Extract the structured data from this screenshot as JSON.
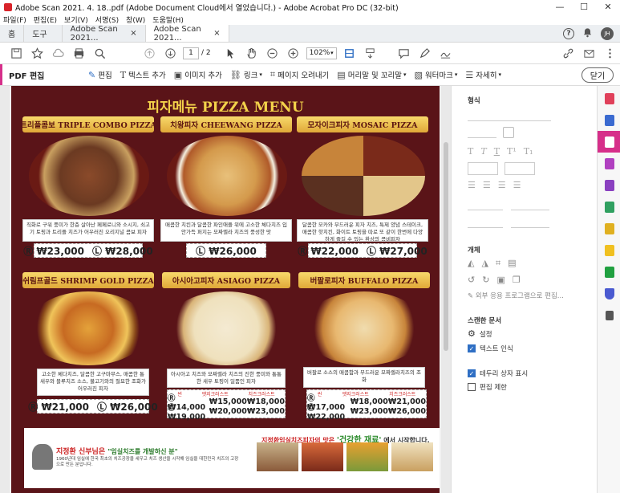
{
  "window": {
    "title": "Adobe Scan 2021. 4. 18..pdf (Adobe Document Cloud에서 열었습니다.) - Adobe Acrobat Pro DC (32-bit)",
    "minimize": "—",
    "maximize": "☐",
    "close": "✕"
  },
  "menu": [
    "파일(F)",
    "편집(E)",
    "보기(V)",
    "서명(S)",
    "창(W)",
    "도움말(H)"
  ],
  "tabs": {
    "home": "홈",
    "tools": "도구",
    "doc1": "Adobe Scan 2021...",
    "doc2": "Adobe Scan 2021...",
    "close": "×"
  },
  "topright": {
    "help": "?",
    "avatar": "JH"
  },
  "toolbar": {
    "page_current": "1",
    "page_total": "/ 2",
    "zoom": "102%"
  },
  "editbar": {
    "title": "PDF 편집",
    "edit": "편집",
    "add_text": "텍스트 추가",
    "add_image": "이미지 추가",
    "link": "링크",
    "crop": "페이지 오려내기",
    "header_footer": "머리말 및 꼬리말",
    "watermark": "워터마크",
    "more": "자세히",
    "close": "닫기"
  },
  "menu_page": {
    "title": "피자메뉴 PIZZA MENU",
    "pizzas": [
      {
        "name": "트리플콤보 TRIPLE COMBO PIZZA",
        "desc": "직화로 구워 풍미가 한층 살아난 페페로니와 소시지, 쇠고기 토핑과 트리플 치즈가 어우러진 오리지널 콤보 피자",
        "price_r": "Ⓡ ₩23,000",
        "price_l": "Ⓛ ₩28,000"
      },
      {
        "name": "치왕피자 CHEEWANG PIZZA",
        "desc": "매콤한 치킨과 달콤한 파인애플 위에 고소한 체다치즈 입안가득 퍼지는 모짜렐라 치즈의 풍성한 맛",
        "price_l": "Ⓛ ₩26,000"
      },
      {
        "name": "모자이크피자 MOSAIC PIZZA",
        "desc": "달콤한 모카와 부드러운 피자 치즈, 특제 양념 스테이크, 매콤한 핫치킨, 화이트 토핑을 따로 또 같이 한번에 다양하게 즐길 수 있는 환상의 콤비피자",
        "price_r": "Ⓡ ₩22,000",
        "price_l": "Ⓛ ₩27,000"
      },
      {
        "name": "쉬림프골드 SHRIMP GOLD PIZZA",
        "desc": "고소한 체다치즈, 달콤한 고구마무스, 매콤한 통새우와 블루치즈 소스, 불고기와의 절묘한 조화가 어우러진 피자",
        "price_r": "Ⓡ ₩21,000",
        "price_l": "Ⓛ ₩26,000"
      },
      {
        "name": "아시아고피자 ASIAGO PIZZA",
        "desc": "아시아고 치즈와 모짜렐라 치즈의 진한 풍미와 통통한 새우 토핑이 일품인 피자",
        "table_head": [
          "씬",
          "엣지크러스트",
          "치즈크러스트"
        ],
        "row_r": [
          "Ⓡ ₩14,000",
          "₩15,000",
          "₩18,000"
        ],
        "row_l": [
          "Ⓛ ₩19,000",
          "₩20,000",
          "₩23,000"
        ]
      },
      {
        "name": "버팔로피자 BUFFALO PIZZA",
        "desc": "버팔로 소스의 매콤함과 부드러운 모짜렐라치즈의 조화",
        "table_head": [
          "씬",
          "엣지크러스트",
          "치즈크러스트"
        ],
        "row_r": [
          "Ⓡ ₩17,000",
          "₩18,000",
          "₩21,000"
        ],
        "row_l": [
          "Ⓛ ₩22,000",
          "₩23,000",
          "₩26,000"
        ]
      }
    ],
    "bottom_left_title": "지정환 신부님은",
    "bottom_left_quote": "\"임실치즈를 개발하신 분\"",
    "bottom_left_body": "1960년대 임실에 한국 최초의 치즈공장을 세우고 치즈 생산을 시작해 임실을 대한민국 치즈의 고장으로 만든 분입니다.",
    "bottom_right_title_a": "지정환임실치즈피자의 맛은 ",
    "bottom_right_title_b": "'건강한 재료'",
    "bottom_right_title_c": " 에서 시작합니다."
  },
  "panel": {
    "format": "형식",
    "object": "개체",
    "external_edit": "외부 응용 프로그램으로 편집...",
    "scanned": "스캔한 문서",
    "settings": "설정",
    "ocr": "텍스트 인식",
    "show_boxes": "테두리 상자 표시",
    "restrict": "편집 제한",
    "ocr_checked": true,
    "show_boxes_checked": true,
    "restrict_checked": false
  },
  "colors": {
    "accent": "#d62f8a",
    "blue": "#2f6fc4",
    "page_bg": "#5a1418",
    "banner": "#f2c550"
  }
}
